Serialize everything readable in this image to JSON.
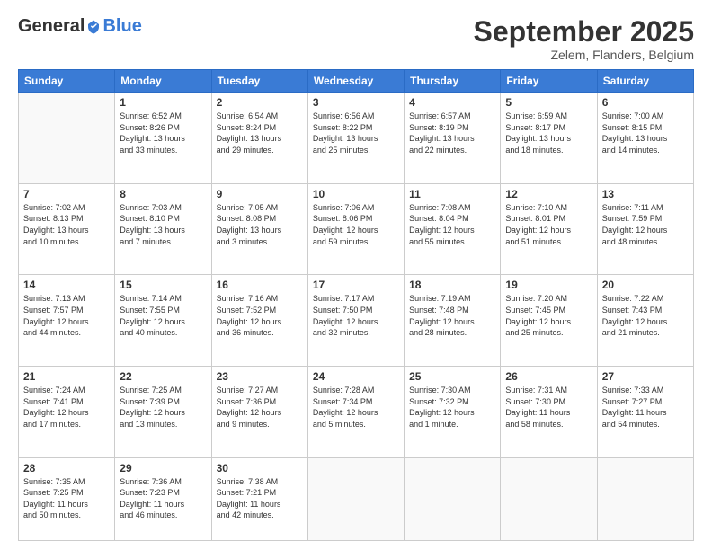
{
  "header": {
    "logo": {
      "part1": "General",
      "part2": "Blue"
    },
    "title": "September 2025",
    "location": "Zelem, Flanders, Belgium"
  },
  "days_of_week": [
    "Sunday",
    "Monday",
    "Tuesday",
    "Wednesday",
    "Thursday",
    "Friday",
    "Saturday"
  ],
  "weeks": [
    [
      {
        "day": "",
        "info": ""
      },
      {
        "day": "1",
        "info": "Sunrise: 6:52 AM\nSunset: 8:26 PM\nDaylight: 13 hours\nand 33 minutes."
      },
      {
        "day": "2",
        "info": "Sunrise: 6:54 AM\nSunset: 8:24 PM\nDaylight: 13 hours\nand 29 minutes."
      },
      {
        "day": "3",
        "info": "Sunrise: 6:56 AM\nSunset: 8:22 PM\nDaylight: 13 hours\nand 25 minutes."
      },
      {
        "day": "4",
        "info": "Sunrise: 6:57 AM\nSunset: 8:19 PM\nDaylight: 13 hours\nand 22 minutes."
      },
      {
        "day": "5",
        "info": "Sunrise: 6:59 AM\nSunset: 8:17 PM\nDaylight: 13 hours\nand 18 minutes."
      },
      {
        "day": "6",
        "info": "Sunrise: 7:00 AM\nSunset: 8:15 PM\nDaylight: 13 hours\nand 14 minutes."
      }
    ],
    [
      {
        "day": "7",
        "info": "Sunrise: 7:02 AM\nSunset: 8:13 PM\nDaylight: 13 hours\nand 10 minutes."
      },
      {
        "day": "8",
        "info": "Sunrise: 7:03 AM\nSunset: 8:10 PM\nDaylight: 13 hours\nand 7 minutes."
      },
      {
        "day": "9",
        "info": "Sunrise: 7:05 AM\nSunset: 8:08 PM\nDaylight: 13 hours\nand 3 minutes."
      },
      {
        "day": "10",
        "info": "Sunrise: 7:06 AM\nSunset: 8:06 PM\nDaylight: 12 hours\nand 59 minutes."
      },
      {
        "day": "11",
        "info": "Sunrise: 7:08 AM\nSunset: 8:04 PM\nDaylight: 12 hours\nand 55 minutes."
      },
      {
        "day": "12",
        "info": "Sunrise: 7:10 AM\nSunset: 8:01 PM\nDaylight: 12 hours\nand 51 minutes."
      },
      {
        "day": "13",
        "info": "Sunrise: 7:11 AM\nSunset: 7:59 PM\nDaylight: 12 hours\nand 48 minutes."
      }
    ],
    [
      {
        "day": "14",
        "info": "Sunrise: 7:13 AM\nSunset: 7:57 PM\nDaylight: 12 hours\nand 44 minutes."
      },
      {
        "day": "15",
        "info": "Sunrise: 7:14 AM\nSunset: 7:55 PM\nDaylight: 12 hours\nand 40 minutes."
      },
      {
        "day": "16",
        "info": "Sunrise: 7:16 AM\nSunset: 7:52 PM\nDaylight: 12 hours\nand 36 minutes."
      },
      {
        "day": "17",
        "info": "Sunrise: 7:17 AM\nSunset: 7:50 PM\nDaylight: 12 hours\nand 32 minutes."
      },
      {
        "day": "18",
        "info": "Sunrise: 7:19 AM\nSunset: 7:48 PM\nDaylight: 12 hours\nand 28 minutes."
      },
      {
        "day": "19",
        "info": "Sunrise: 7:20 AM\nSunset: 7:45 PM\nDaylight: 12 hours\nand 25 minutes."
      },
      {
        "day": "20",
        "info": "Sunrise: 7:22 AM\nSunset: 7:43 PM\nDaylight: 12 hours\nand 21 minutes."
      }
    ],
    [
      {
        "day": "21",
        "info": "Sunrise: 7:24 AM\nSunset: 7:41 PM\nDaylight: 12 hours\nand 17 minutes."
      },
      {
        "day": "22",
        "info": "Sunrise: 7:25 AM\nSunset: 7:39 PM\nDaylight: 12 hours\nand 13 minutes."
      },
      {
        "day": "23",
        "info": "Sunrise: 7:27 AM\nSunset: 7:36 PM\nDaylight: 12 hours\nand 9 minutes."
      },
      {
        "day": "24",
        "info": "Sunrise: 7:28 AM\nSunset: 7:34 PM\nDaylight: 12 hours\nand 5 minutes."
      },
      {
        "day": "25",
        "info": "Sunrise: 7:30 AM\nSunset: 7:32 PM\nDaylight: 12 hours\nand 1 minute."
      },
      {
        "day": "26",
        "info": "Sunrise: 7:31 AM\nSunset: 7:30 PM\nDaylight: 11 hours\nand 58 minutes."
      },
      {
        "day": "27",
        "info": "Sunrise: 7:33 AM\nSunset: 7:27 PM\nDaylight: 11 hours\nand 54 minutes."
      }
    ],
    [
      {
        "day": "28",
        "info": "Sunrise: 7:35 AM\nSunset: 7:25 PM\nDaylight: 11 hours\nand 50 minutes."
      },
      {
        "day": "29",
        "info": "Sunrise: 7:36 AM\nSunset: 7:23 PM\nDaylight: 11 hours\nand 46 minutes."
      },
      {
        "day": "30",
        "info": "Sunrise: 7:38 AM\nSunset: 7:21 PM\nDaylight: 11 hours\nand 42 minutes."
      },
      {
        "day": "",
        "info": ""
      },
      {
        "day": "",
        "info": ""
      },
      {
        "day": "",
        "info": ""
      },
      {
        "day": "",
        "info": ""
      }
    ]
  ]
}
